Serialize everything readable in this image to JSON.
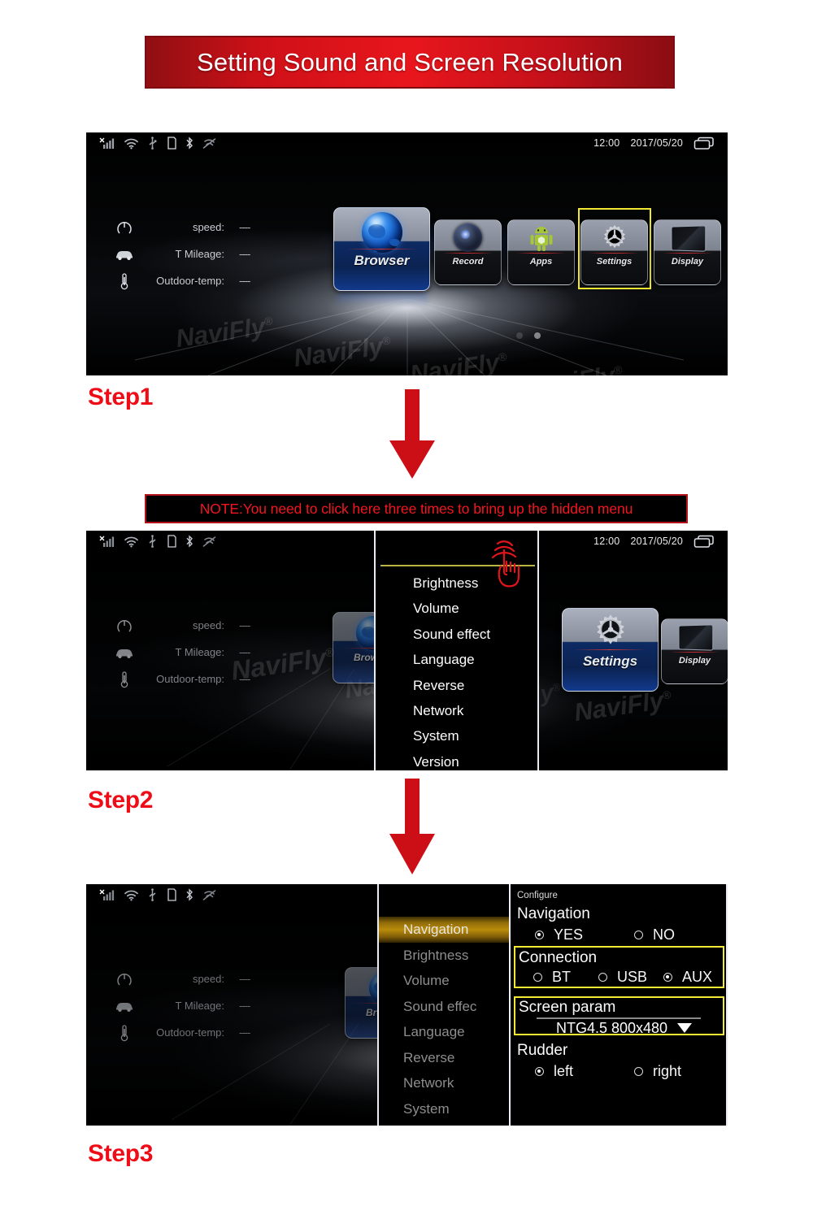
{
  "title": "Setting Sound and Screen Resolution",
  "note": "NOTE:You need to click here three times to bring up the hidden menu",
  "steps": {
    "step1_label": "Step1",
    "step2_label": "Step2",
    "step3_label": "Step3"
  },
  "statusbar": {
    "time": "12:00",
    "date": "2017/05/20",
    "icons": [
      "signal-no-service-icon",
      "wifi-icon",
      "usb-icon",
      "sd-card-icon",
      "bluetooth-icon",
      "mute-icon"
    ],
    "right_icon": "recent-apps-icon"
  },
  "dashboard": {
    "rows": [
      {
        "icon": "speedometer-icon",
        "label": "speed:",
        "value": "----"
      },
      {
        "icon": "car-icon",
        "label": "T Mileage:",
        "value": "----"
      },
      {
        "icon": "thermometer-icon",
        "label": "Outdoor-temp:",
        "value": "----"
      }
    ]
  },
  "home_tiles": [
    {
      "label": "Browser",
      "icon": "globe-icon"
    },
    {
      "label": "Record",
      "icon": "camera-icon"
    },
    {
      "label": "Apps",
      "icon": "android-icon"
    },
    {
      "label": "Settings",
      "icon": "gear-icon"
    },
    {
      "label": "Display",
      "icon": "monitor-icon"
    }
  ],
  "watermark": "NaviFly",
  "hidden_menu": {
    "items": [
      "Brightness",
      "Volume",
      "Sound effect",
      "Language",
      "Reverse",
      "Network",
      "System",
      "Version"
    ],
    "tap_icon": "triple-tap-hand-icon"
  },
  "settings_menu": {
    "selected": "Navigation",
    "items": [
      "Navigation",
      "Brightness",
      "Volume",
      "Sound effec",
      "Language",
      "Reverse",
      "Network",
      "System"
    ]
  },
  "configure": {
    "kicker": "Configure",
    "navigation": {
      "title": "Navigation",
      "options": [
        {
          "label": "YES",
          "selected": true
        },
        {
          "label": "NO",
          "selected": false
        }
      ]
    },
    "connection": {
      "title": "Connection",
      "options": [
        {
          "label": "BT",
          "selected": false
        },
        {
          "label": "USB",
          "selected": false
        },
        {
          "label": "AUX",
          "selected": true
        }
      ]
    },
    "screen_param": {
      "title": "Screen param",
      "value": "NTG4.5  800x480",
      "caret": "chevron-down-icon"
    },
    "rudder": {
      "title": "Rudder",
      "options": [
        {
          "label": "left",
          "selected": true
        },
        {
          "label": "right",
          "selected": false
        }
      ]
    }
  },
  "colors": {
    "brand_red": "#ee0d17",
    "highlight_yellow": "#f4ea36",
    "banner_red": "#cf1018",
    "menu_gold": "#b98c0c"
  }
}
